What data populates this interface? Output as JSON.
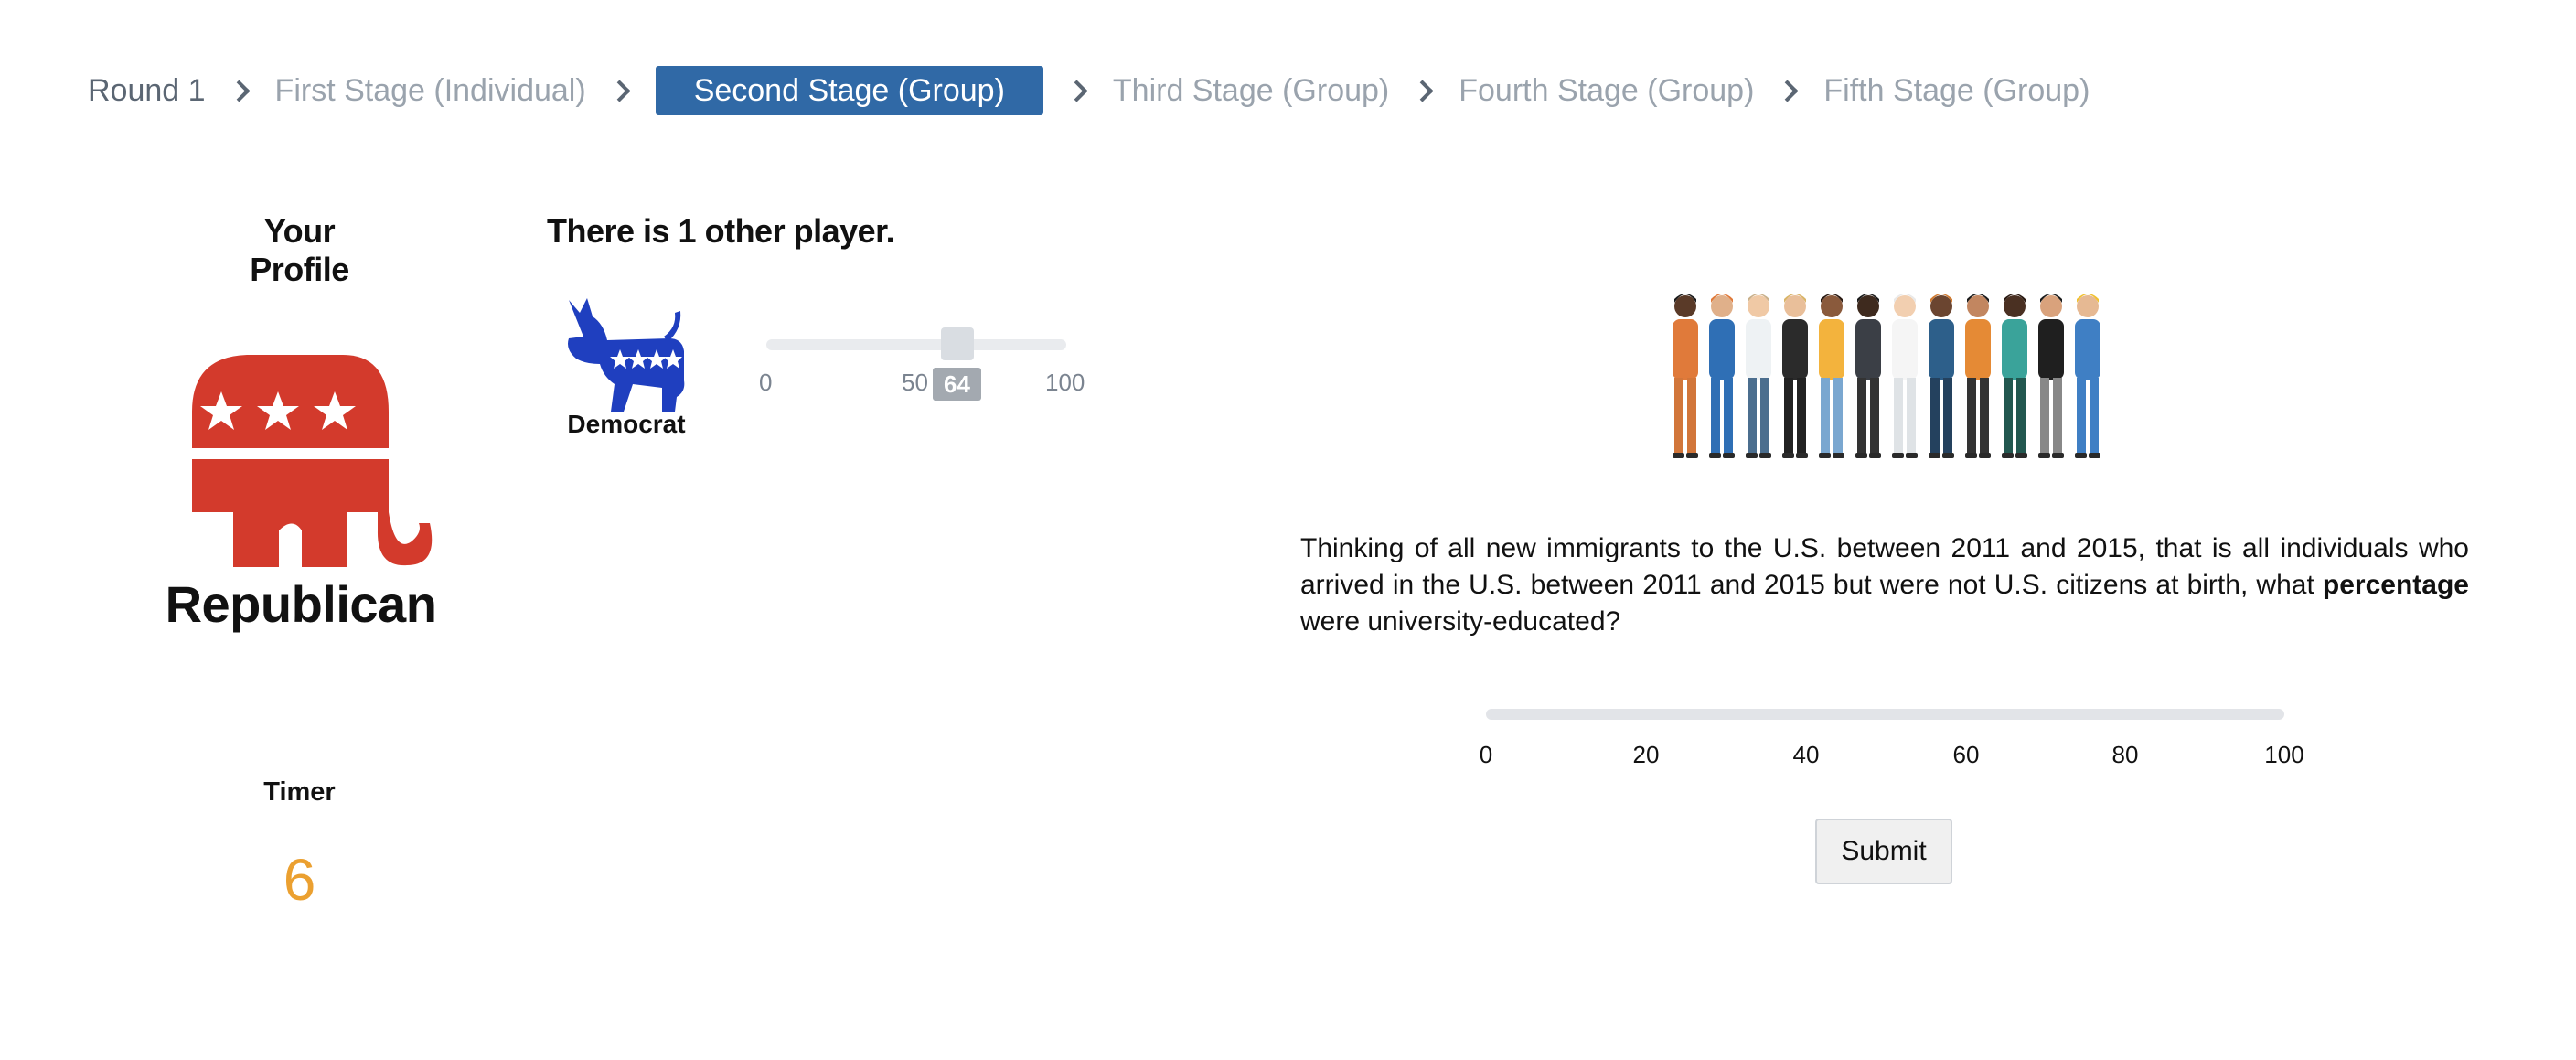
{
  "breadcrumb": {
    "items": [
      {
        "label": "Round 1",
        "state": "done"
      },
      {
        "label": "First Stage (Individual)",
        "state": "inactive"
      },
      {
        "label": "Second Stage (Group)",
        "state": "active"
      },
      {
        "label": "Third Stage (Group)",
        "state": "inactive"
      },
      {
        "label": "Fourth Stage (Group)",
        "state": "inactive"
      },
      {
        "label": "Fifth Stage (Group)",
        "state": "inactive"
      }
    ]
  },
  "profile": {
    "heading": "Your Profile",
    "party_label": "Republican",
    "party_icon": "republican-elephant-icon",
    "party_color": "#d33a2c"
  },
  "timer": {
    "label": "Timer",
    "value": "6",
    "color": "#eba030"
  },
  "other_players": {
    "heading": "There is 1 other player.",
    "players": [
      {
        "party_label": "Democrat",
        "party_icon": "democrat-donkey-icon",
        "party_color": "#1f3fbf",
        "slider": {
          "min": "0",
          "mid": "50",
          "max": "100",
          "value": "64"
        }
      }
    ]
  },
  "question": {
    "image_icon": "immigrants-group-illustration",
    "text_before": "Thinking of all new immigrants to the U.S. between 2011 and 2015, that is all individuals who arrived in the U.S. between 2011 and 2015 but were not U.S. citizens at birth, what ",
    "text_bold": "percentage",
    "text_after": " were university-educated?",
    "slider_ticks": [
      "0",
      "20",
      "40",
      "60",
      "80",
      "100"
    ],
    "submit_label": "Submit"
  },
  "colors": {
    "accent": "#3069a6",
    "breadcrumb_inactive": "#9aa3ad"
  }
}
